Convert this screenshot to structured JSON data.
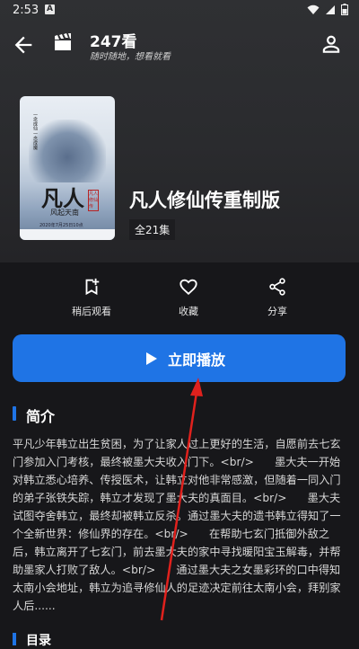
{
  "status": {
    "time": "2:53",
    "notif_letter": "A"
  },
  "appbar": {
    "title": "247看",
    "subtitle": "随时随地，想看就看"
  },
  "show": {
    "title": "凡人修仙传重制版",
    "episodes": "全21集",
    "poster": {
      "title": "凡人",
      "subtitle": "风起天南",
      "side_text": "一念成仙 一念成魔",
      "seal": "凡人修仙传",
      "date": "2020年7月25日10点"
    }
  },
  "actions": [
    {
      "label": "稍后观看",
      "icon": "bookmark-add-icon"
    },
    {
      "label": "收藏",
      "icon": "heart-icon"
    },
    {
      "label": "分享",
      "icon": "share-icon"
    }
  ],
  "play_button": {
    "label": "立即播放"
  },
  "section": {
    "title": "简介",
    "synopsis": "平凡少年韩立出生贫困，为了让家人过上更好的生活，自愿前去七玄门参加入门考核，最终被墨大夫收入门下。<br/>      墨大夫一开始对韩立悉心培养、传授医术，让韩立对他非常感激，但随着一同入门的弟子张铁失踪，韩立才发现了墨大夫的真面目。<br/>      墨大夫试图夺舍韩立，最终却被韩立反杀。通过墨大夫的遗书韩立得知了一个全新世界：修仙界的存在。<br/>      在帮助七玄门抵御外敌之后，韩立离开了七玄门，前去墨大夫的家中寻找暖阳宝玉解毒，并帮助墨家人打败了敌人。<br/>      通过墨大夫之女墨彩环的口中得知太南小会地址，韩立为追寻修仙人的足迹决定前往太南小会，拜别家人后......"
  },
  "next_section": {
    "title": "目录"
  },
  "colors": {
    "accent": "#1f74e5",
    "background": "#17171a",
    "annotation_arrow": "#e0211d"
  }
}
